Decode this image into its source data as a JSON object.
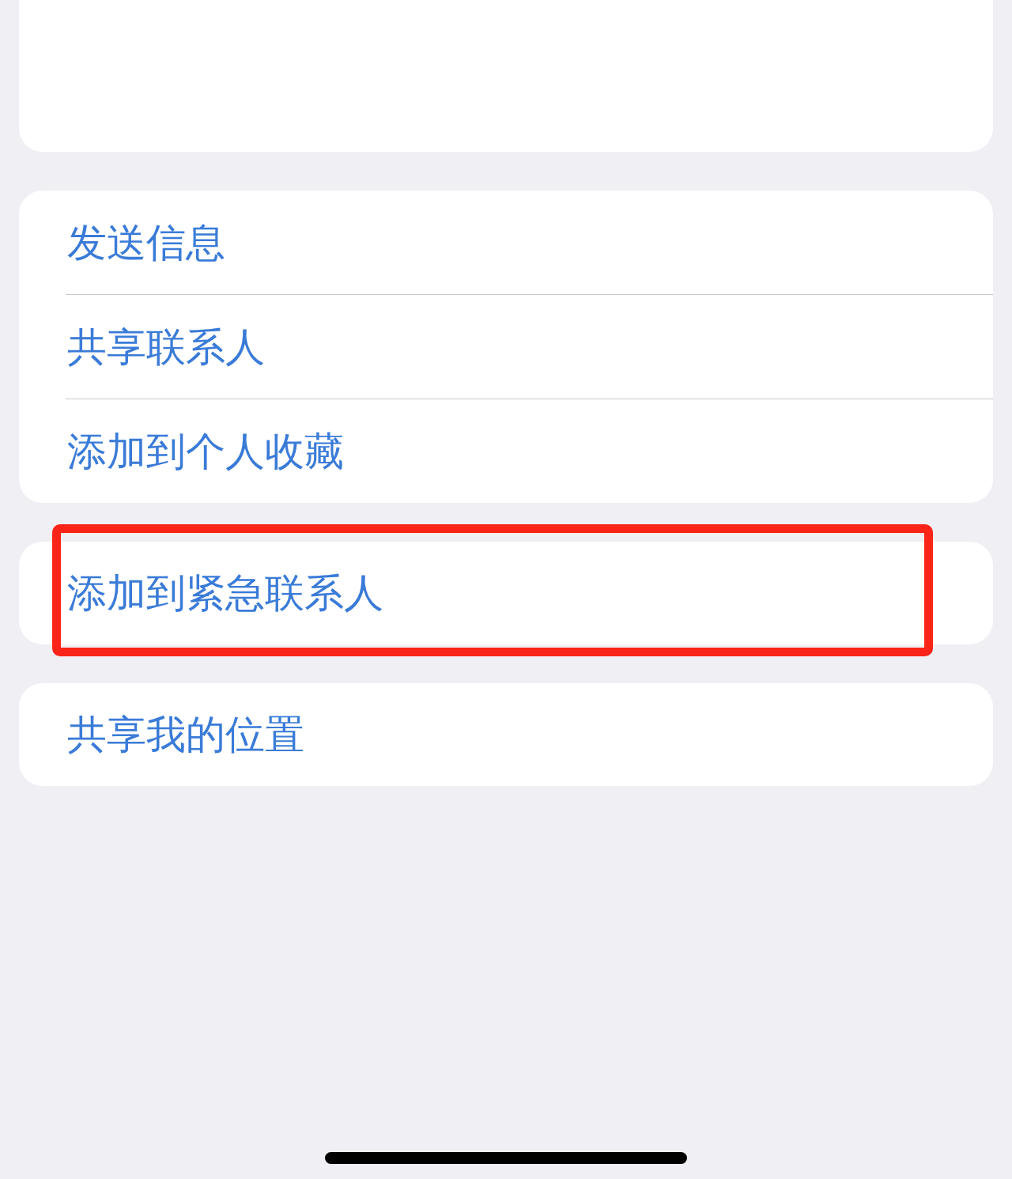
{
  "groups": [
    {
      "items": [
        {
          "label": "发送信息",
          "highlighted": false
        },
        {
          "label": "共享联系人",
          "highlighted": false
        },
        {
          "label": "添加到个人收藏",
          "highlighted": false
        }
      ]
    },
    {
      "items": [
        {
          "label": "添加到紧急联系人",
          "highlighted": true
        }
      ]
    },
    {
      "items": [
        {
          "label": "共享我的位置",
          "highlighted": false
        }
      ]
    }
  ]
}
